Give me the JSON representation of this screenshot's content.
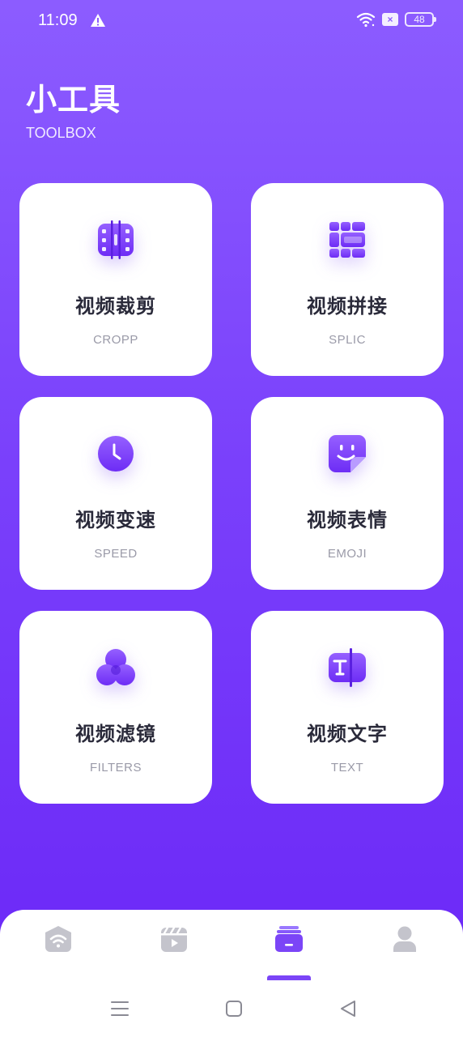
{
  "status_bar": {
    "time": "11:09",
    "battery": "48"
  },
  "header": {
    "title": "小工具",
    "subtitle": "TOOLBOX"
  },
  "tools": [
    {
      "title": "视频裁剪",
      "subtitle": "CROPP",
      "icon": "crop-film-icon"
    },
    {
      "title": "视频拼接",
      "subtitle": "SPLIC",
      "icon": "splice-grid-icon"
    },
    {
      "title": "视频变速",
      "subtitle": "SPEED",
      "icon": "clock-icon"
    },
    {
      "title": "视频表情",
      "subtitle": "EMOJI",
      "icon": "sticker-smile-icon"
    },
    {
      "title": "视频滤镜",
      "subtitle": "FILTERS",
      "icon": "filter-circles-icon"
    },
    {
      "title": "视频文字",
      "subtitle": "TEXT",
      "icon": "text-box-icon"
    }
  ],
  "colors": {
    "accent": "#7b45f7",
    "background_top": "#8c5cff",
    "background_bottom": "#6a26f7",
    "nav_inactive": "#c4c4cc"
  },
  "bottom_nav": {
    "items": [
      "wifi-home-icon",
      "video-clapper-icon",
      "toolbox-icon",
      "user-icon"
    ],
    "active_index": 2
  }
}
